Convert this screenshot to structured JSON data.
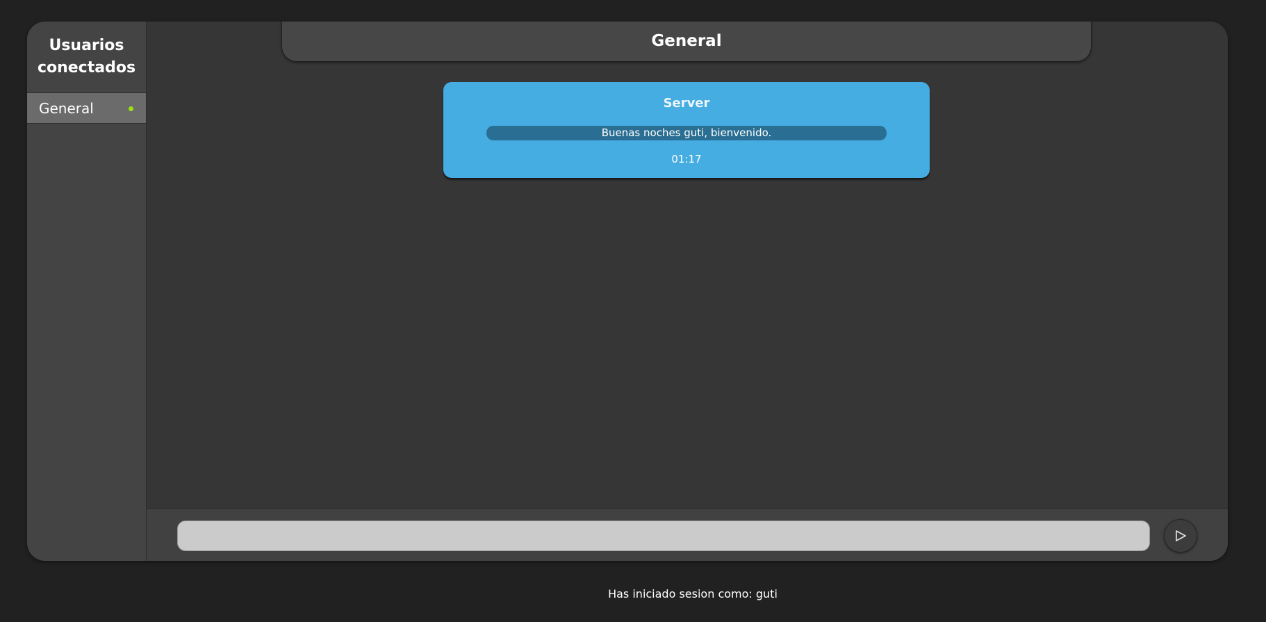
{
  "sidebar": {
    "title": "Usuarios conectados",
    "items": [
      {
        "label": "General",
        "status": "online",
        "status_color": "#9be10e"
      }
    ]
  },
  "chat": {
    "title": "General",
    "messages": [
      {
        "sender": "Server",
        "text": "Buenas noches guti, bienvenido.",
        "time": "01:17",
        "bubble_color": "#45ade2"
      }
    ]
  },
  "composer": {
    "input_value": "",
    "send_icon": "send-icon"
  },
  "footer": {
    "session_text": "Has iniciado sesion como: guti"
  }
}
